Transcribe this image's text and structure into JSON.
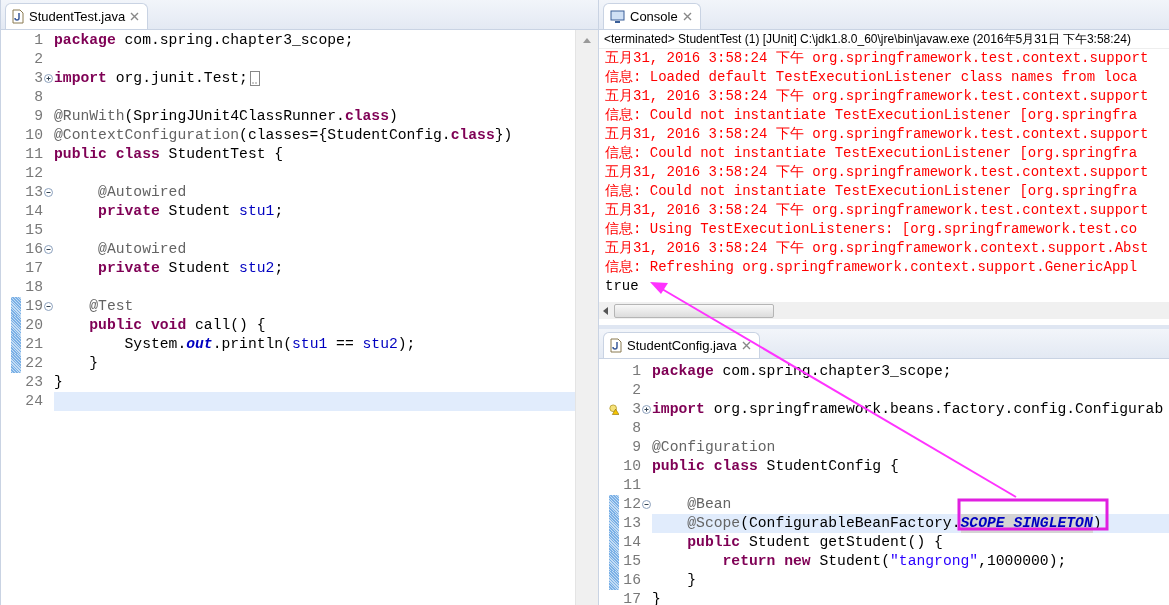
{
  "left_editor": {
    "tab": {
      "label": "StudentTest.java"
    },
    "lines": [
      {
        "number": "1",
        "changed": false,
        "current": false,
        "tokens": [
          {
            "kind": "keyword",
            "text": "package"
          },
          {
            "kind": "plain",
            "text": " com.spring.chapter3_scope;"
          }
        ]
      },
      {
        "number": "2",
        "changed": false,
        "current": false
      },
      {
        "number": "3",
        "collapsed": true,
        "elided": true,
        "changed": false,
        "current": false,
        "tokens": [
          {
            "kind": "keyword",
            "text": "import"
          },
          {
            "kind": "plain",
            "text": " org.junit.Test;"
          }
        ]
      },
      {
        "number": "8",
        "changed": false,
        "current": false
      },
      {
        "number": "9",
        "changed": false,
        "current": false,
        "tokens": [
          {
            "kind": "annotation",
            "text": "@RunWith"
          },
          {
            "kind": "plain",
            "text": "(SpringJUnit4ClassRunner."
          },
          {
            "kind": "keyword",
            "text": "class"
          },
          {
            "kind": "plain",
            "text": ")"
          }
        ]
      },
      {
        "number": "10",
        "changed": false,
        "current": false,
        "tokens": [
          {
            "kind": "annotation",
            "text": "@ContextConfiguration"
          },
          {
            "kind": "plain",
            "text": "(classes={StudentConfig."
          },
          {
            "kind": "keyword",
            "text": "class"
          },
          {
            "kind": "plain",
            "text": "})"
          }
        ]
      },
      {
        "number": "11",
        "changed": false,
        "current": false,
        "tokens": [
          {
            "kind": "keyword",
            "text": "public"
          },
          {
            "kind": "keyword",
            "text": " class"
          },
          {
            "kind": "plain",
            "text": " StudentTest {"
          }
        ]
      },
      {
        "number": "12",
        "changed": false,
        "current": false
      },
      {
        "number": "13",
        "collapsed": false,
        "changed": false,
        "current": false,
        "tokens": [
          {
            "kind": "annotation",
            "text": "     @Autowired"
          }
        ]
      },
      {
        "number": "14",
        "changed": false,
        "current": false,
        "tokens": [
          {
            "kind": "keyword",
            "text": "     private"
          },
          {
            "kind": "plain",
            "text": " Student "
          },
          {
            "kind": "field",
            "text": "stu1"
          },
          {
            "kind": "plain",
            "text": ";"
          }
        ]
      },
      {
        "number": "15",
        "changed": false,
        "current": false
      },
      {
        "number": "16",
        "collapsed": false,
        "changed": false,
        "current": false,
        "tokens": [
          {
            "kind": "annotation",
            "text": "     @Autowired"
          }
        ]
      },
      {
        "number": "17",
        "changed": false,
        "current": false,
        "tokens": [
          {
            "kind": "keyword",
            "text": "     private"
          },
          {
            "kind": "plain",
            "text": " Student "
          },
          {
            "kind": "field",
            "text": "stu2"
          },
          {
            "kind": "plain",
            "text": ";"
          }
        ]
      },
      {
        "number": "18",
        "changed": false,
        "current": false
      },
      {
        "number": "19",
        "collapsed": false,
        "changed": true,
        "current": false,
        "tokens": [
          {
            "kind": "annotation",
            "text": "    @Test"
          }
        ]
      },
      {
        "number": "20",
        "changed": true,
        "current": false,
        "tokens": [
          {
            "kind": "keyword",
            "text": "    public"
          },
          {
            "kind": "keyword",
            "text": " void"
          },
          {
            "kind": "plain",
            "text": " call() {"
          }
        ]
      },
      {
        "number": "21",
        "changed": true,
        "current": false,
        "tokens": [
          {
            "kind": "plain",
            "text": "        System."
          },
          {
            "kind": "static",
            "text": "out"
          },
          {
            "kind": "plain",
            "text": ".println("
          },
          {
            "kind": "field",
            "text": "stu1"
          },
          {
            "kind": "plain",
            "text": " == "
          },
          {
            "kind": "field",
            "text": "stu2"
          },
          {
            "kind": "plain",
            "text": ");"
          }
        ]
      },
      {
        "number": "22",
        "changed": true,
        "current": false,
        "tokens": [
          {
            "kind": "plain",
            "text": "    }"
          }
        ]
      },
      {
        "number": "23",
        "changed": false,
        "current": false,
        "tokens": [
          {
            "kind": "plain",
            "text": "}"
          }
        ]
      },
      {
        "number": "24",
        "changed": false,
        "current": true
      }
    ]
  },
  "console": {
    "tab": {
      "label": "Console"
    },
    "header": "<terminated> StudentTest (1) [JUnit] C:\\jdk1.8.0_60\\jre\\bin\\javaw.exe (2016年5月31日 下午3:58:24)",
    "lines": [
      {
        "kind": "stderr",
        "text": "五月31, 2016 3:58:24 下午 org.springframework.test.context.support"
      },
      {
        "kind": "stderr",
        "text": "信息: Loaded default TestExecutionListener class names from loca"
      },
      {
        "kind": "stderr",
        "text": "五月31, 2016 3:58:24 下午 org.springframework.test.context.support"
      },
      {
        "kind": "stderr",
        "text": "信息: Could not instantiate TestExecutionListener [org.springfra"
      },
      {
        "kind": "stderr",
        "text": "五月31, 2016 3:58:24 下午 org.springframework.test.context.support"
      },
      {
        "kind": "stderr",
        "text": "信息: Could not instantiate TestExecutionListener [org.springfra"
      },
      {
        "kind": "stderr",
        "text": "五月31, 2016 3:58:24 下午 org.springframework.test.context.support"
      },
      {
        "kind": "stderr",
        "text": "信息: Could not instantiate TestExecutionListener [org.springfra"
      },
      {
        "kind": "stderr",
        "text": "五月31, 2016 3:58:24 下午 org.springframework.test.context.support"
      },
      {
        "kind": "stderr",
        "text": "信息: Using TestExecutionListeners: [org.springframework.test.co"
      },
      {
        "kind": "stderr",
        "text": "五月31, 2016 3:58:24 下午 org.springframework.context.support.Abst"
      },
      {
        "kind": "stderr",
        "text": "信息: Refreshing org.springframework.context.support.GenericAppl"
      },
      {
        "kind": "stdout",
        "text": "true"
      }
    ]
  },
  "right_editor": {
    "tab": {
      "label": "StudentConfig.java"
    },
    "lines": [
      {
        "number": "1",
        "changed": false,
        "current": false,
        "tokens": [
          {
            "kind": "keyword",
            "text": "package"
          },
          {
            "kind": "plain",
            "text": " com.spring.chapter3_scope;"
          }
        ]
      },
      {
        "number": "2",
        "changed": false,
        "current": false
      },
      {
        "number": "3",
        "collapsed": true,
        "warning": true,
        "changed": false,
        "current": false,
        "tokens": [
          {
            "kind": "keyword",
            "text": "import"
          },
          {
            "kind": "plain",
            "text": " org.springframework.beans.factory.config.Configurab"
          }
        ]
      },
      {
        "number": "8",
        "changed": false,
        "current": false
      },
      {
        "number": "9",
        "changed": false,
        "current": false,
        "tokens": [
          {
            "kind": "annotation",
            "text": "@Configuration"
          }
        ]
      },
      {
        "number": "10",
        "changed": false,
        "current": false,
        "tokens": [
          {
            "kind": "keyword",
            "text": "public"
          },
          {
            "kind": "keyword",
            "text": " class"
          },
          {
            "kind": "plain",
            "text": " StudentConfig {"
          }
        ]
      },
      {
        "number": "11",
        "changed": false,
        "current": false
      },
      {
        "number": "12",
        "collapsed": false,
        "changed": true,
        "current": false,
        "tokens": [
          {
            "kind": "annotation",
            "text": "    @Bean"
          }
        ]
      },
      {
        "number": "13",
        "changed": true,
        "current": true,
        "tokens": [
          {
            "kind": "annotation",
            "text": "    @Scope"
          },
          {
            "kind": "plain",
            "text": "(ConfigurableBeanFactory."
          },
          {
            "kind": "constant",
            "text": "SCOPE_SINGLETON"
          },
          {
            "kind": "plain",
            "text": ")"
          }
        ]
      },
      {
        "number": "14",
        "changed": true,
        "current": false,
        "tokens": [
          {
            "kind": "keyword",
            "text": "    public"
          },
          {
            "kind": "plain",
            "text": " Student getStudent() {"
          }
        ]
      },
      {
        "number": "15",
        "changed": true,
        "current": false,
        "tokens": [
          {
            "kind": "keyword",
            "text": "        return"
          },
          {
            "kind": "keyword",
            "text": " new"
          },
          {
            "kind": "plain",
            "text": " Student("
          },
          {
            "kind": "string",
            "text": "\"tangrong\""
          },
          {
            "kind": "plain",
            "text": ",1000000);"
          }
        ]
      },
      {
        "number": "16",
        "changed": true,
        "current": false,
        "tokens": [
          {
            "kind": "plain",
            "text": "    }"
          }
        ]
      },
      {
        "number": "17",
        "changed": false,
        "current": false,
        "tokens": [
          {
            "kind": "plain",
            "text": "}"
          }
        ]
      }
    ]
  }
}
